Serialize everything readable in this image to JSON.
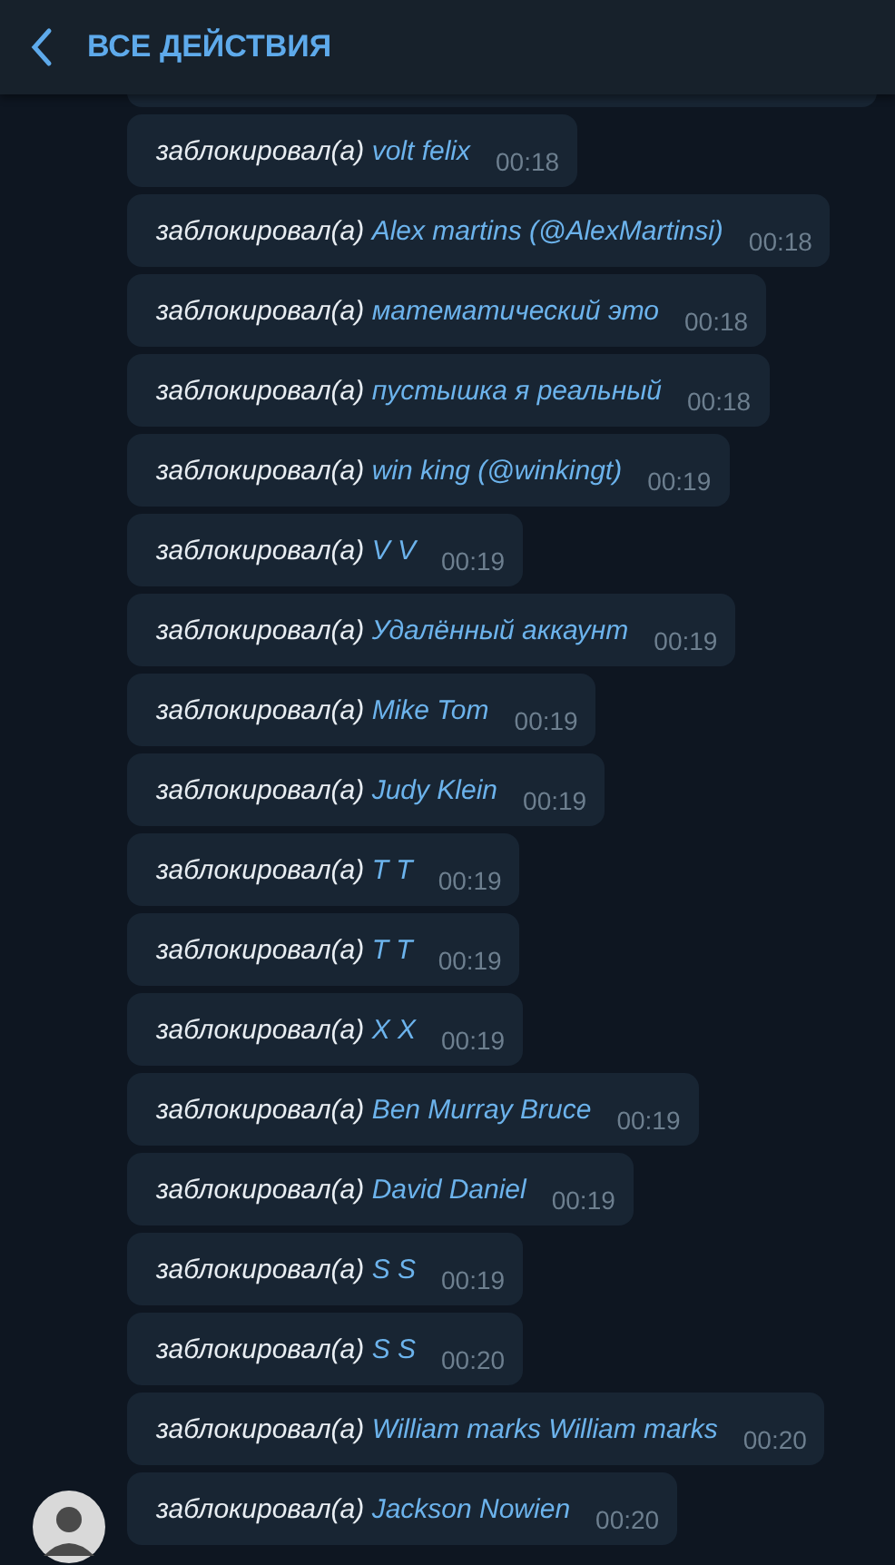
{
  "header": {
    "title": "ВСЕ ДЕЙСТВИЯ"
  },
  "messages": [
    {
      "action": "заблокировал(а)",
      "user": "volt felix",
      "time": "00:18",
      "avatar": false
    },
    {
      "action": "заблокировал(а)",
      "user": "Alex martins (@AlexMartinsi)",
      "time": "00:18",
      "avatar": false
    },
    {
      "action": "заблокировал(а)",
      "user": "математический это",
      "time": "00:18",
      "avatar": false
    },
    {
      "action": "заблокировал(а)",
      "user": "пустышка я реальный",
      "time": "00:18",
      "avatar": false
    },
    {
      "action": "заблокировал(а)",
      "user": "win king (@winkingt)",
      "time": "00:19",
      "avatar": false
    },
    {
      "action": "заблокировал(а)",
      "user": "V V",
      "time": "00:19",
      "avatar": false
    },
    {
      "action": "заблокировал(а)",
      "user": "Удалённый аккаунт",
      "time": "00:19",
      "avatar": false
    },
    {
      "action": "заблокировал(а)",
      "user": "Mike Tom",
      "time": "00:19",
      "avatar": false
    },
    {
      "action": "заблокировал(а)",
      "user": "Judy Klein",
      "time": "00:19",
      "avatar": false
    },
    {
      "action": "заблокировал(а)",
      "user": "T T",
      "time": "00:19",
      "avatar": false
    },
    {
      "action": "заблокировал(а)",
      "user": "T T",
      "time": "00:19",
      "avatar": false
    },
    {
      "action": "заблокировал(а)",
      "user": "X X",
      "time": "00:19",
      "avatar": false
    },
    {
      "action": "заблокировал(а)",
      "user": "Ben Murray Bruce",
      "time": "00:19",
      "avatar": false
    },
    {
      "action": "заблокировал(а)",
      "user": "David Daniel",
      "time": "00:19",
      "avatar": false
    },
    {
      "action": "заблокировал(а)",
      "user": "S S",
      "time": "00:19",
      "avatar": false
    },
    {
      "action": "заблокировал(а)",
      "user": "S S",
      "time": "00:20",
      "avatar": false
    },
    {
      "action": "заблокировал(а)",
      "user": "William marks William marks",
      "time": "00:20",
      "avatar": false
    },
    {
      "action": "заблокировал(а)",
      "user": "Jackson Nowien",
      "time": "00:20",
      "avatar": true
    }
  ]
}
